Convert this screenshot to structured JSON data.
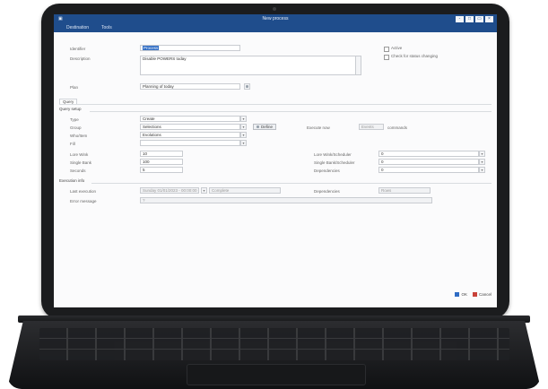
{
  "window": {
    "title": "New process",
    "app_icon": "app-icon",
    "controls": [
      "-",
      "□",
      "▭",
      "×"
    ]
  },
  "menu": [
    "Destination",
    "Tools"
  ],
  "form": {
    "identifier": {
      "label": "Identifier",
      "value": "Process"
    },
    "description": {
      "label": "Description",
      "value": "Disable POWERS today"
    },
    "active": {
      "label": "Active"
    },
    "check_all": {
      "label": "Check for status changing"
    },
    "plan": {
      "label": "Plan",
      "value": "Planning of today"
    }
  },
  "tab": "Query",
  "query": {
    "title": "Query setup",
    "rows": [
      {
        "label": "Type",
        "value": "Create"
      },
      {
        "label": "Group",
        "value": "Selections"
      },
      {
        "label": "Who/Item",
        "value": "Evolutions"
      },
      {
        "label": "Fill",
        "value": ""
      }
    ],
    "define_button": "Define",
    "reset_label": "Execute now",
    "reset_value": "Events",
    "reset_suffix": "commands",
    "left_numbers": [
      {
        "label": "Lore Wink",
        "value": "10"
      },
      {
        "label": "Single Bank",
        "value": "100"
      },
      {
        "label": "Seconds",
        "value": "5"
      }
    ],
    "right_numbers": [
      {
        "label": "Lore Wink/Scheduler",
        "value": "0"
      },
      {
        "label": "Single Bank/Scheduler",
        "value": "0"
      },
      {
        "label": "Dependencies",
        "value": "0"
      }
    ]
  },
  "execution": {
    "title": "Execution info",
    "last_run": {
      "label": "Last execution",
      "value": "Sunday 01/01/2023 - 00:00:00",
      "extra": "Complete"
    },
    "duration": {
      "label": "Dependencies",
      "value": "Rows"
    },
    "error": {
      "label": "Error message",
      "value": "?"
    }
  },
  "footer": {
    "ok": "OK",
    "cancel": "Cancel"
  }
}
